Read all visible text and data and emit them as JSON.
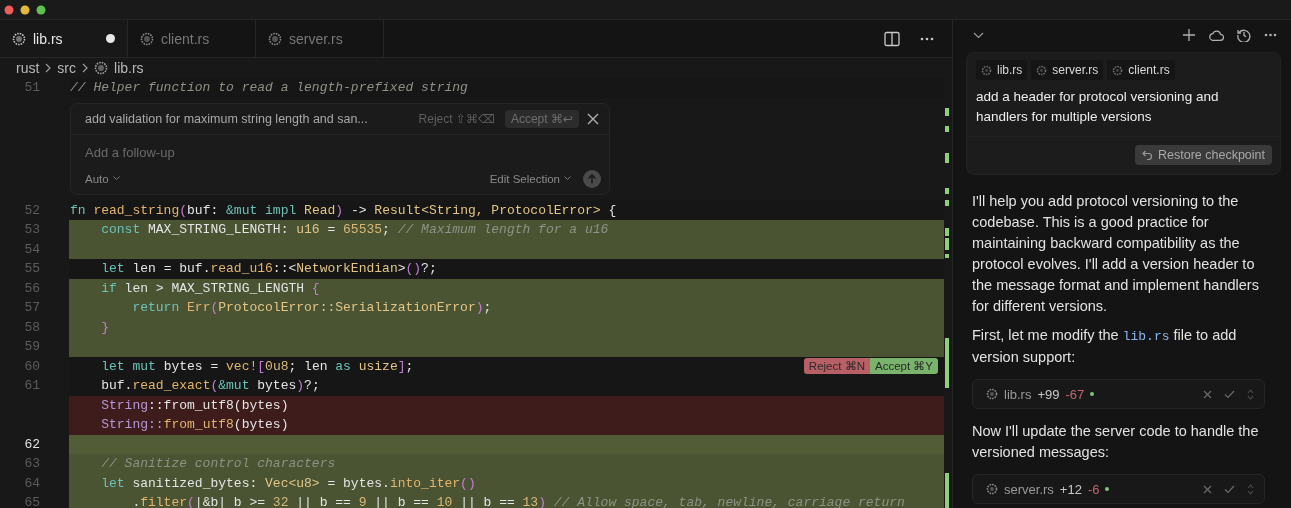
{
  "editor": {
    "tabs": [
      {
        "label": "lib.rs",
        "selected": true,
        "modified": true
      },
      {
        "label": "client.rs",
        "selected": false,
        "modified": false
      },
      {
        "label": "server.rs",
        "selected": false,
        "modified": false
      }
    ],
    "breadcrumb": [
      "rust",
      "src",
      "lib.rs"
    ],
    "inline_prompt": {
      "prompt": "add validation for maximum string length and san...",
      "reject": "Reject ⇧⌘⌫",
      "accept": "Accept ⌘↩",
      "follow_up_placeholder": "Add a follow-up",
      "mode": "Auto",
      "scope": "Edit Selection"
    },
    "lines": [
      {
        "number": "51",
        "added": false,
        "removed": false,
        "current": false,
        "tokens": [
          {
            "kind": "cmt",
            "text": "// Helper function to read a length-prefixed string"
          }
        ]
      },
      {
        "number": "52",
        "added": false,
        "removed": false,
        "current": false,
        "tokens": [
          {
            "kind": "kw",
            "text": "fn "
          },
          {
            "kind": "fn",
            "text": "read_string"
          },
          {
            "kind": "pn",
            "text": "("
          },
          {
            "kind": "id",
            "text": "buf: "
          },
          {
            "kind": "kw",
            "text": "&mut impl "
          },
          {
            "kind": "ty",
            "text": "Read"
          },
          {
            "kind": "pn",
            "text": ")"
          },
          {
            "kind": "id",
            "text": " -> "
          },
          {
            "kind": "ty",
            "text": "Result<String, ProtocolError>"
          },
          {
            "kind": "id",
            "text": " {"
          }
        ]
      },
      {
        "number": "53",
        "added": true,
        "removed": false,
        "current": false,
        "tokens": [
          {
            "kind": "kw",
            "text": "    const "
          },
          {
            "kind": "id",
            "text": "MAX_STRING_LENGTH: "
          },
          {
            "kind": "ty",
            "text": "u16"
          },
          {
            "kind": "id",
            "text": " = "
          },
          {
            "kind": "num",
            "text": "65535"
          },
          {
            "kind": "id",
            "text": "; "
          },
          {
            "kind": "cmt",
            "text": "// Maximum length for a u16"
          }
        ]
      },
      {
        "number": "54",
        "added": true,
        "removed": false,
        "current": false
      },
      {
        "number": "55",
        "added": false,
        "removed": false,
        "current": false,
        "tokens": [
          {
            "kind": "kw",
            "text": "    let "
          },
          {
            "kind": "id",
            "text": "len = buf."
          },
          {
            "kind": "fn",
            "text": "read_u16"
          },
          {
            "kind": "id",
            "text": "::<"
          },
          {
            "kind": "ty",
            "text": "NetworkEndian"
          },
          {
            "kind": "id",
            "text": ">"
          },
          {
            "kind": "pn",
            "text": "()"
          },
          {
            "kind": "id",
            "text": "?;"
          }
        ]
      },
      {
        "number": "56",
        "added": true,
        "removed": false,
        "current": false,
        "tokens": [
          {
            "kind": "kw",
            "text": "    if "
          },
          {
            "kind": "id",
            "text": "len > MAX_STRING_LENGTH "
          },
          {
            "kind": "pn",
            "text": "{"
          }
        ]
      },
      {
        "number": "57",
        "added": true,
        "removed": false,
        "current": false,
        "tokens": [
          {
            "kind": "kw",
            "text": "        return "
          },
          {
            "kind": "fn",
            "text": "Err"
          },
          {
            "kind": "pn",
            "text": "("
          },
          {
            "kind": "ty",
            "text": "ProtocolError::SerializationError"
          },
          {
            "kind": "pn",
            "text": ")"
          },
          {
            "kind": "id",
            "text": ";"
          }
        ]
      },
      {
        "number": "58",
        "added": true,
        "removed": false,
        "current": false,
        "tokens": [
          {
            "kind": "pn",
            "text": "    }"
          }
        ]
      },
      {
        "number": "59",
        "added": true,
        "removed": false,
        "current": false
      },
      {
        "number": "60",
        "added": false,
        "removed": false,
        "current": false,
        "tokens": [
          {
            "kind": "kw",
            "text": "    let mut "
          },
          {
            "kind": "id",
            "text": "bytes = "
          },
          {
            "kind": "fn",
            "text": "vec!"
          },
          {
            "kind": "pn",
            "text": "["
          },
          {
            "kind": "num",
            "text": "0u8"
          },
          {
            "kind": "id",
            "text": "; len "
          },
          {
            "kind": "kw",
            "text": "as "
          },
          {
            "kind": "ty",
            "text": "usize"
          },
          {
            "kind": "pn",
            "text": "]"
          },
          {
            "kind": "id",
            "text": ";"
          }
        ],
        "actions": {
          "reject": "Reject ⌘N",
          "accept": "Accept ⌘Y"
        }
      },
      {
        "number": "61",
        "added": false,
        "removed": false,
        "current": false,
        "tokens": [
          {
            "kind": "id",
            "text": "    buf."
          },
          {
            "kind": "fn",
            "text": "read_exact"
          },
          {
            "kind": "pn",
            "text": "("
          },
          {
            "kind": "kw",
            "text": "&mut "
          },
          {
            "kind": "id",
            "text": "bytes"
          },
          {
            "kind": "pn",
            "text": ")"
          },
          {
            "kind": "id",
            "text": "?;"
          }
        ]
      },
      {
        "added": false,
        "removed": true,
        "current": false,
        "tokens": [
          {
            "kind": "ty",
            "text": "    String"
          },
          {
            "kind": "id",
            "text": "::from_utf8(bytes)"
          }
        ]
      },
      {
        "added": false,
        "removed": true,
        "current": false,
        "tokens": [
          {
            "kind": "ty",
            "text": "    String::"
          },
          {
            "kind": "fn",
            "text": "from_utf8"
          },
          {
            "kind": "id",
            "text": "(bytes)"
          }
        ]
      },
      {
        "number": "62",
        "added": true,
        "removed": false,
        "current": true
      },
      {
        "number": "63",
        "added": true,
        "removed": false,
        "current": false,
        "tokens": [
          {
            "kind": "cmt",
            "text": "    // Sanitize control characters"
          }
        ]
      },
      {
        "number": "64",
        "added": true,
        "removed": false,
        "current": false,
        "tokens": [
          {
            "kind": "kw",
            "text": "    let "
          },
          {
            "kind": "id",
            "text": "sanitized_bytes: "
          },
          {
            "kind": "ty",
            "text": "Vec<u8>"
          },
          {
            "kind": "id",
            "text": " = bytes."
          },
          {
            "kind": "fn",
            "text": "into_iter"
          },
          {
            "kind": "pn",
            "text": "()"
          }
        ]
      },
      {
        "number": "65",
        "added": true,
        "removed": false,
        "current": false,
        "tokens": [
          {
            "kind": "id",
            "text": "        ."
          },
          {
            "kind": "fn",
            "text": "filter"
          },
          {
            "kind": "pn",
            "text": "("
          },
          {
            "kind": "id",
            "text": "|&b| b >= "
          },
          {
            "kind": "num",
            "text": "32"
          },
          {
            "kind": "id",
            "text": " || b == "
          },
          {
            "kind": "num",
            "text": "9"
          },
          {
            "kind": "id",
            "text": " || b == "
          },
          {
            "kind": "num",
            "text": "10"
          },
          {
            "kind": "id",
            "text": " || b == "
          },
          {
            "kind": "num",
            "text": "13"
          },
          {
            "kind": "pn",
            "text": ")"
          },
          {
            "kind": "cmt",
            "text": " // Allow space, tab, newline, carriage return"
          }
        ]
      }
    ]
  },
  "chat": {
    "context_files": [
      "lib.rs",
      "server.rs",
      "client.rs"
    ],
    "user_message": "add a header for protocol versioning and handlers for multiple versions",
    "restore_button": "Restore checkpoint",
    "messages": [
      {
        "kind": "text",
        "parts": [
          {
            "text": "I'll help you add protocol versioning to the codebase. This is a good practice for maintaining backward compatibility as the protocol evolves. I'll add a version header to the message format and implement handlers for different versions.",
            "code": false
          }
        ]
      },
      {
        "kind": "text",
        "parts": [
          {
            "text": "First, let me modify the ",
            "code": false
          },
          {
            "text": "lib.rs",
            "code": true
          },
          {
            "text": " file to add version support:",
            "code": false
          }
        ]
      },
      {
        "kind": "file",
        "name": "lib.rs",
        "added": "+99",
        "removed": "-67"
      },
      {
        "kind": "text",
        "parts": [
          {
            "text": "Now I'll update the server code to handle the versioned messages:",
            "code": false
          }
        ]
      },
      {
        "kind": "file",
        "name": "server.rs",
        "added": "+12",
        "removed": "-6"
      }
    ]
  }
}
